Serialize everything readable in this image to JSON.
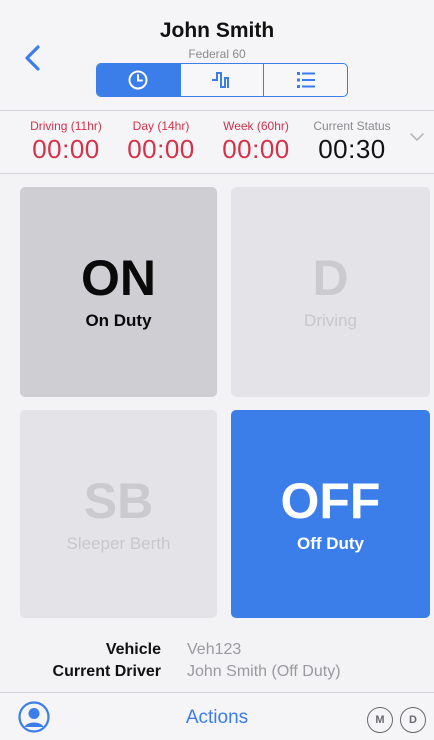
{
  "header": {
    "title": "John Smith",
    "subtitle": "Federal 60",
    "tabs": [
      {
        "icon": "clock-icon",
        "active": true
      },
      {
        "icon": "log-graph-icon",
        "active": false
      },
      {
        "icon": "list-icon",
        "active": false
      }
    ]
  },
  "status": {
    "driving": {
      "label": "Driving (11hr)",
      "value": "00:00"
    },
    "day": {
      "label": "Day (14hr)",
      "value": "00:00"
    },
    "week": {
      "label": "Week (60hr)",
      "value": "00:00"
    },
    "current": {
      "label": "Current Status",
      "value": "00:30"
    }
  },
  "tiles": {
    "on": {
      "code": "ON",
      "name": "On Duty"
    },
    "driving": {
      "code": "D",
      "name": "Driving"
    },
    "sleeper": {
      "code": "SB",
      "name": "Sleeper Berth"
    },
    "off": {
      "code": "OFF",
      "name": "Off Duty",
      "selected": true
    }
  },
  "info": {
    "vehicle_label": "Vehicle",
    "vehicle_value": "Veh123",
    "driver_label": "Current Driver",
    "driver_value": "John Smith (Off Duty)"
  },
  "bottom": {
    "actions_label": "Actions",
    "m_label": "M",
    "d_label": "D"
  },
  "colors": {
    "accent": "#3b7de9",
    "warning": "#d2324a"
  }
}
